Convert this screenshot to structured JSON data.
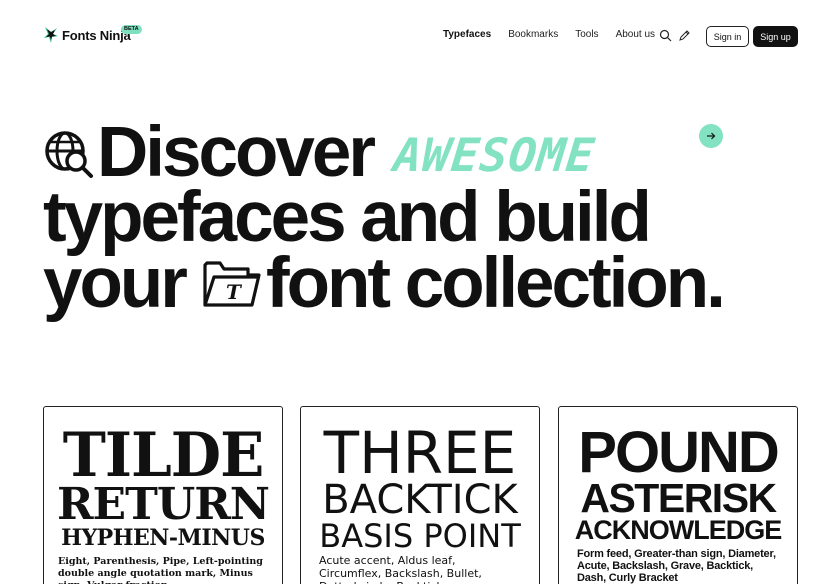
{
  "brand": {
    "name": "Fonts Ninja",
    "badge": "BETA",
    "accent_color": "#82e2c1"
  },
  "nav": {
    "items": [
      "Typefaces",
      "Bookmarks",
      "Tools",
      "About us"
    ],
    "active": "Typefaces",
    "search_icon": "search-icon",
    "extension_icon": "pen-icon",
    "signin_label": "Sign in",
    "signup_label": "Sign up"
  },
  "hero": {
    "word1": "Discover",
    "highlight": "AWESOME",
    "line2": "typefaces and build",
    "line3a": "your",
    "line3b": "font collection.",
    "globe_icon": "globe-search-icon",
    "folder_icon": "font-folder-icon",
    "arrow_icon": "arrow-right-icon"
  },
  "cards": [
    {
      "title1": "TILDE",
      "title2": "RETURN",
      "title3": "HYPHEN-MINUS",
      "desc": "Eight, Parenthesis, Pipe, Left-pointing double angle quotation mark, Minus sign, Vulgar fraction"
    },
    {
      "title1": "THREE",
      "title2": "BACKTICK",
      "title3": "BASIS POINT",
      "desc": "Acute accent, Aldus leaf, Circumflex, Backslash, Bullet, Dotted circle, Backtick"
    },
    {
      "title1": "POUND",
      "title2": "ASTERISK",
      "title3": "ACKNOWLEDGE",
      "desc": "Form feed, Greater-than sign, Diameter, Acute, Backslash, Grave, Backtick, Dash, Curly Bracket"
    }
  ]
}
